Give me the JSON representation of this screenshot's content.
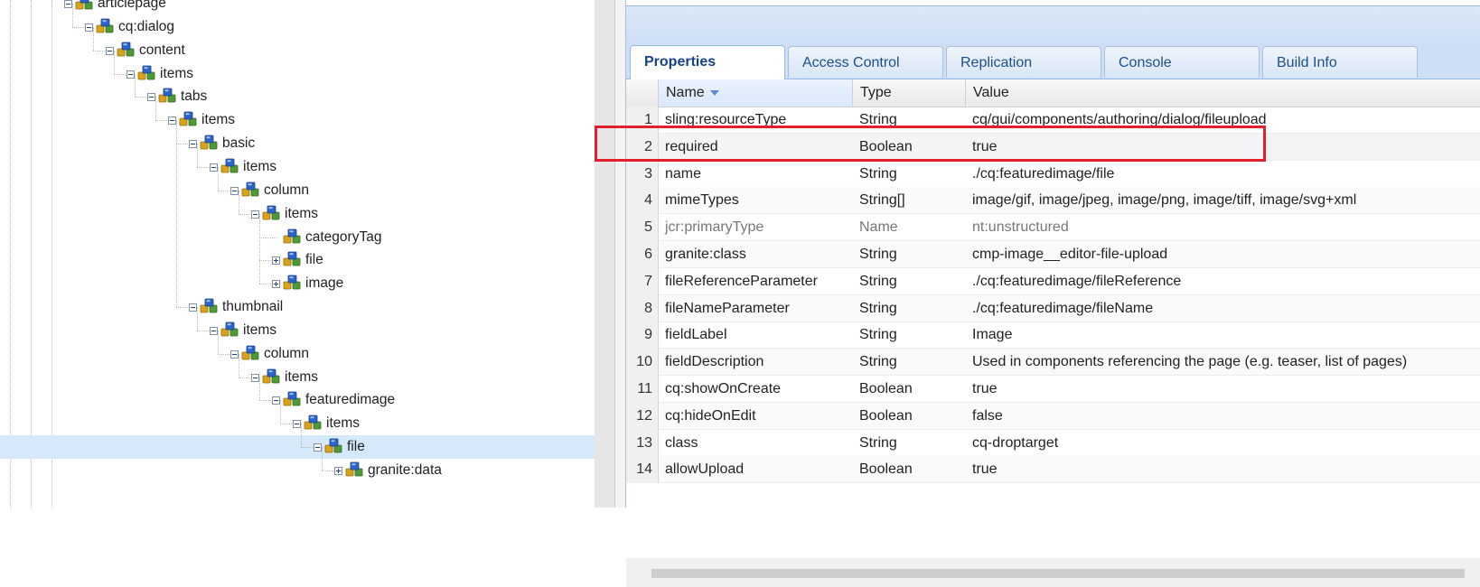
{
  "tree": {
    "nodes": [
      {
        "label": "articlepage",
        "toggle": "minus"
      },
      {
        "label": "cq:dialog",
        "toggle": "minus"
      },
      {
        "label": "content",
        "toggle": "minus"
      },
      {
        "label": "items",
        "toggle": "minus"
      },
      {
        "label": "tabs",
        "toggle": "minus"
      },
      {
        "label": "items",
        "toggle": "minus"
      },
      {
        "label": "basic",
        "toggle": "minus"
      },
      {
        "label": "items",
        "toggle": "minus"
      },
      {
        "label": "column",
        "toggle": "minus"
      },
      {
        "label": "items",
        "toggle": "minus"
      },
      {
        "label": "categoryTag",
        "toggle": "none"
      },
      {
        "label": "file",
        "toggle": "plus"
      },
      {
        "label": "image",
        "toggle": "plus"
      },
      {
        "label": "thumbnail",
        "toggle": "minus"
      },
      {
        "label": "items",
        "toggle": "minus"
      },
      {
        "label": "column",
        "toggle": "minus"
      },
      {
        "label": "items",
        "toggle": "minus"
      },
      {
        "label": "featuredimage",
        "toggle": "minus"
      },
      {
        "label": "items",
        "toggle": "minus"
      },
      {
        "label": "file",
        "toggle": "minus",
        "selected": true
      },
      {
        "label": "granite:data",
        "toggle": "plus"
      }
    ]
  },
  "tabs": [
    "Properties",
    "Access Control",
    "Replication",
    "Console",
    "Build Info"
  ],
  "grid": {
    "headers": {
      "name": "Name",
      "type": "Type",
      "value": "Value"
    },
    "rows": [
      {
        "n": "1",
        "name": "sling:resourceType",
        "type": "String",
        "value": "cq/gui/components/authoring/dialog/fileupload"
      },
      {
        "n": "2",
        "name": "required",
        "type": "Boolean",
        "value": "true"
      },
      {
        "n": "3",
        "name": "name",
        "type": "String",
        "value": "./cq:featuredimage/file"
      },
      {
        "n": "4",
        "name": "mimeTypes",
        "type": "String[]",
        "value": "image/gif, image/jpeg, image/png, image/tiff, image/svg+xml"
      },
      {
        "n": "5",
        "name": "jcr:primaryType",
        "type": "Name",
        "value": "nt:unstructured"
      },
      {
        "n": "6",
        "name": "granite:class",
        "type": "String",
        "value": "cmp-image__editor-file-upload"
      },
      {
        "n": "7",
        "name": "fileReferenceParameter",
        "type": "String",
        "value": "./cq:featuredimage/fileReference"
      },
      {
        "n": "8",
        "name": "fileNameParameter",
        "type": "String",
        "value": "./cq:featuredimage/fileName"
      },
      {
        "n": "9",
        "name": "fieldLabel",
        "type": "String",
        "value": "Image"
      },
      {
        "n": "10",
        "name": "fieldDescription",
        "type": "String",
        "value": "Used in components referencing the page (e.g. teaser, list of pages)"
      },
      {
        "n": "11",
        "name": "cq:showOnCreate",
        "type": "Boolean",
        "value": "true"
      },
      {
        "n": "12",
        "name": "cq:hideOnEdit",
        "type": "Boolean",
        "value": "false"
      },
      {
        "n": "13",
        "name": "class",
        "type": "String",
        "value": "cq-droptarget"
      },
      {
        "n": "14",
        "name": "allowUpload",
        "type": "Boolean",
        "value": "true"
      }
    ]
  },
  "colors": {
    "highlight_box": "#e0202c",
    "selected_tree_row": "#d6e9fb",
    "tab_text": "#1a4f8a"
  }
}
